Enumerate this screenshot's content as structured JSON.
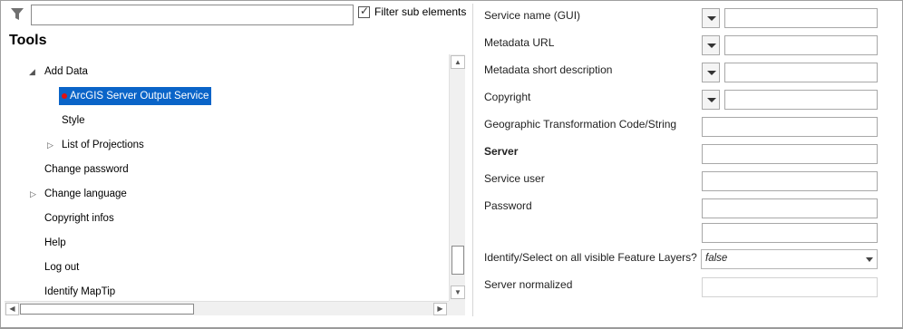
{
  "filter": {
    "search_value": "",
    "checkbox_checked": true,
    "label": "Filter sub elements"
  },
  "tools_title": "Tools",
  "tree": [
    {
      "label": "Add Data",
      "expanded": true
    },
    {
      "label": "ArcGIS Server Output Service",
      "selected": true
    },
    {
      "label": "Style"
    },
    {
      "label": "List of Projections",
      "expanded": false
    },
    {
      "label": "Change password"
    },
    {
      "label": "Change language",
      "expanded": false
    },
    {
      "label": "Copyright infos"
    },
    {
      "label": "Help"
    },
    {
      "label": "Log out"
    },
    {
      "label": "Identify MapTip"
    }
  ],
  "properties": [
    {
      "label": "Service name (GUI)",
      "value": ""
    },
    {
      "label": "Metadata URL",
      "value": ""
    },
    {
      "label": "Metadata short description",
      "value": ""
    },
    {
      "label": "Copyright",
      "value": ""
    },
    {
      "label": "Geographic Transformation Code/String",
      "value": ""
    },
    {
      "label": "Server",
      "value": "",
      "bold": true
    },
    {
      "label": "Service user",
      "value": ""
    },
    {
      "label": "Password",
      "value": ""
    },
    {
      "label": "",
      "value": ""
    },
    {
      "label": "Identify/Select on all visible Feature Layers?",
      "value": "false"
    },
    {
      "label": "Server normalized",
      "value": ""
    }
  ],
  "colors": {
    "selection": "#0a64c8",
    "marker": "#e01010"
  },
  "icons": {
    "filter": "funnel-icon",
    "expanded": "triangle-down-icon",
    "collapsed": "triangle-right-icon"
  }
}
